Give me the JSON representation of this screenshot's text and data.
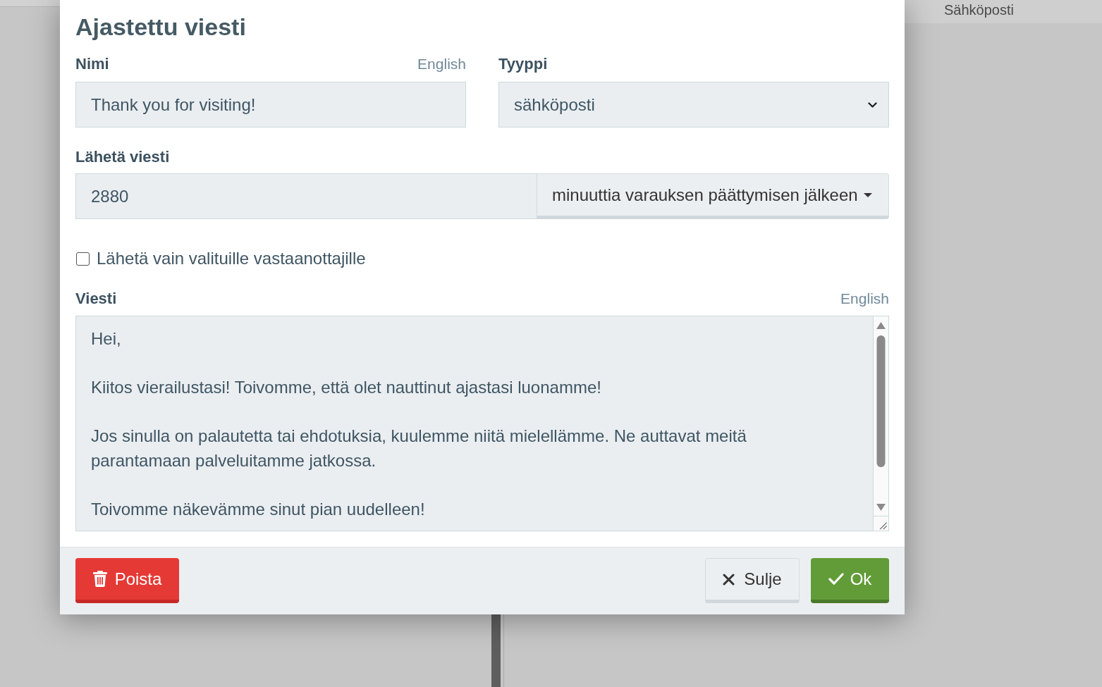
{
  "background": {
    "column_heading": "Sähköposti"
  },
  "dialog": {
    "title": "Ajastettu viesti"
  },
  "name_field": {
    "label": "Nimi",
    "language": "English",
    "value": "Thank you for visiting!"
  },
  "type_field": {
    "label": "Tyyppi",
    "value": "sähköposti"
  },
  "send_time": {
    "label": "Lähetä viesti",
    "value": "2880",
    "unit": "minuuttia varauksen päättymisen jälkeen"
  },
  "recipients_checkbox": {
    "label": "Lähetä vain valituille vastaanottajille",
    "checked": false
  },
  "message_field": {
    "label": "Viesti",
    "language": "English",
    "value": "Hei,\n\nKiitos vierailustasi! Toivomme, että olet nauttinut ajastasi luonamme!\n\nJos sinulla on palautetta tai ehdotuksia, kuulemme niitä mielellämme. Ne auttavat meitä parantamaan palveluitamme jatkossa.\n\nToivomme näkevämme sinut pian uudelleen!"
  },
  "buttons": [
    {
      "kind": "danger",
      "label": "Poista"
    },
    {
      "kind": "secondary",
      "label": "Sulje"
    },
    {
      "kind": "primary",
      "label": "Ok"
    }
  ]
}
